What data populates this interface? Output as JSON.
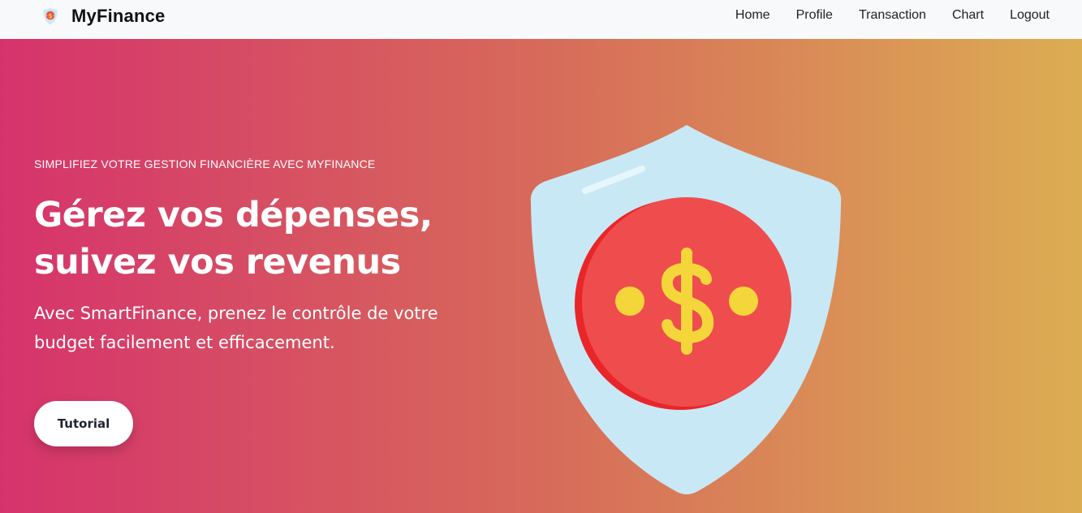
{
  "navbar": {
    "brand": "MyFinance",
    "links": [
      "Home",
      "Profile",
      "Transaction",
      "Chart",
      "Logout"
    ]
  },
  "hero": {
    "eyebrow": "SIMPLIFIEZ VOTRE GESTION FINANCIÈRE AVEC MYFINANCE",
    "headline_line1": "Gérez vos dépenses,",
    "headline_line2": "suivez vos revenus",
    "subtext_line1": "Avec SmartFinance, prenez le contrôle de votre",
    "subtext_line2": "budget facilement et efficacement.",
    "button_label": "Tutorial"
  },
  "icons": {
    "brand_logo": "shield-dollar-icon",
    "illustration": "shield-dollar-illustration"
  },
  "colors": {
    "gradient_start": "#d6336c",
    "gradient_mid": "#d76a5a",
    "gradient_end": "#dcad53",
    "navbar_bg": "#f8f9fb",
    "shield": "#c9e8f5",
    "coin": "#ef4d4d",
    "coin_dark": "#e8262a",
    "dollar": "#f5d63a"
  }
}
